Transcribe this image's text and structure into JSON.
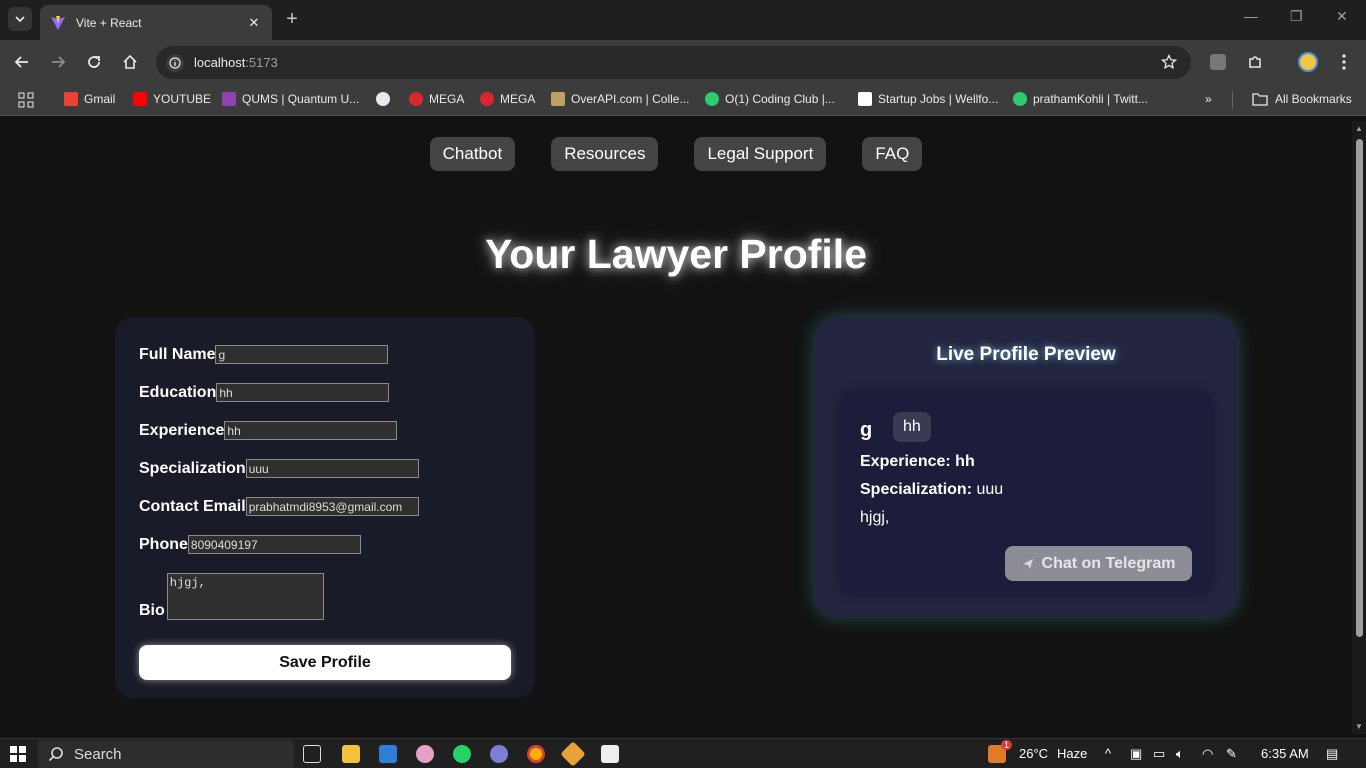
{
  "browser": {
    "tab_title": "Vite + React",
    "url_host": "localhost",
    "url_port": ":5173",
    "bookmarks": [
      {
        "label": "Gmail",
        "color": "#ea4335"
      },
      {
        "label": "YOUTUBE",
        "color": "#ff0000"
      },
      {
        "label": "QUMS | Quantum U...",
        "color": "#8e44ad"
      },
      {
        "label": "",
        "color": "#9aa0a6"
      },
      {
        "label": "MEGA",
        "color": "#d9272e"
      },
      {
        "label": "MEGA",
        "color": "#d9272e"
      },
      {
        "label": "OverAPI.com | Colle...",
        "color": "#c0a060"
      },
      {
        "label": "O(1) Coding Club |...",
        "color": "#2ecc71"
      },
      {
        "label": "Startup Jobs | Wellfo...",
        "color": "#ffffff"
      },
      {
        "label": "prathamKohli | Twitt...",
        "color": "#2ecc71"
      }
    ],
    "all_bookmarks": "All Bookmarks"
  },
  "nav": {
    "items": [
      "Chatbot",
      "Resources",
      "Legal Support",
      "FAQ"
    ]
  },
  "page_title": "Your Lawyer Profile",
  "form": {
    "fields": [
      {
        "label": "Full Name",
        "value": "g"
      },
      {
        "label": "Education",
        "value": "hh"
      },
      {
        "label": "Experience",
        "value": "hh"
      },
      {
        "label": "Specialization",
        "value": "uuu"
      },
      {
        "label": "Contact Email",
        "value": "prabhatmdi8953@gmail.com"
      },
      {
        "label": "Phone",
        "value": "8090409197"
      }
    ],
    "bio_label": "Bio",
    "bio_value": "hjgj,",
    "save_label": "Save Profile"
  },
  "preview": {
    "title": "Live Profile Preview",
    "name": "g",
    "education_badge": "hh",
    "experience_label": "Experience:",
    "experience_value": "hh",
    "specialization_label": "Specialization:",
    "specialization_value": "uuu",
    "bio": "hjgj,",
    "telegram_label": "Chat on Telegram"
  },
  "taskbar": {
    "search_placeholder": "Search",
    "weather_temp": "26°C",
    "weather_desc": "Haze",
    "time": "6:35 AM",
    "notification_count": "1"
  }
}
